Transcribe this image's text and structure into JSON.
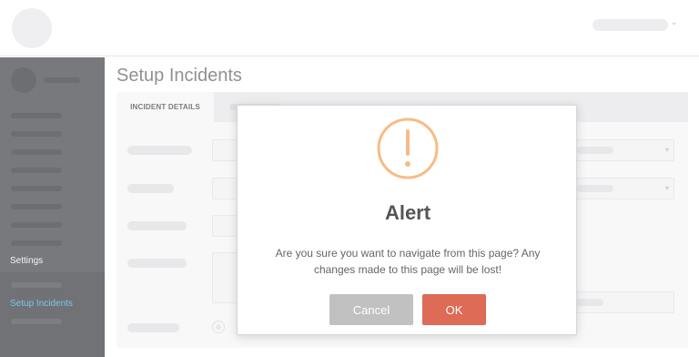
{
  "header": {
    "user_caret": "⌄"
  },
  "sidebar": {
    "settings_label": "Settings",
    "active_item_label": "Setup Incidents"
  },
  "main": {
    "title": "Setup Incidents",
    "tabs": [
      {
        "label": "INCIDENT DETAILS",
        "active": true
      }
    ],
    "select_caret": "▾"
  },
  "dialog": {
    "icon": "exclamation-icon",
    "icon_glyph": "!",
    "title": "Alert",
    "message": "Are you sure you want to navigate from this page? Any changes made to this page will be lost!",
    "cancel_label": "Cancel",
    "ok_label": "OK",
    "colors": {
      "icon": "#f8bb86",
      "ok": "#dd6b55",
      "cancel": "#c1c1c1"
    }
  },
  "colors": {
    "sidebar_bg": "#2f3238",
    "active_link": "#33a8e0"
  }
}
